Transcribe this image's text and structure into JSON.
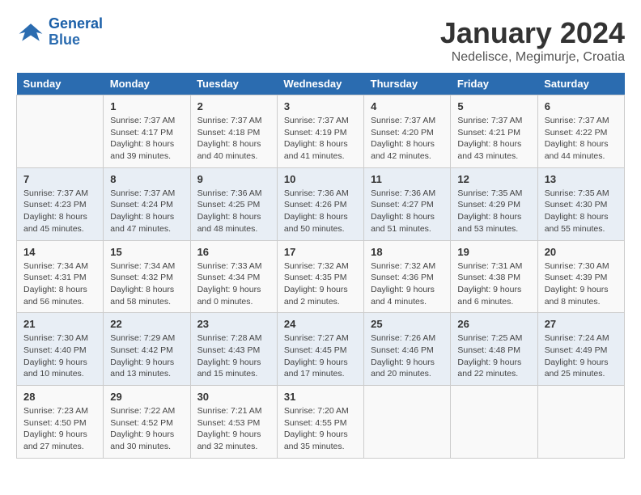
{
  "header": {
    "logo_line1": "General",
    "logo_line2": "Blue",
    "title": "January 2024",
    "subtitle": "Nedelisce, Megimurje, Croatia"
  },
  "calendar": {
    "weekdays": [
      "Sunday",
      "Monday",
      "Tuesday",
      "Wednesday",
      "Thursday",
      "Friday",
      "Saturday"
    ],
    "rows": [
      [
        {
          "day": "",
          "lines": []
        },
        {
          "day": "1",
          "lines": [
            "Sunrise: 7:37 AM",
            "Sunset: 4:17 PM",
            "Daylight: 8 hours",
            "and 39 minutes."
          ]
        },
        {
          "day": "2",
          "lines": [
            "Sunrise: 7:37 AM",
            "Sunset: 4:18 PM",
            "Daylight: 8 hours",
            "and 40 minutes."
          ]
        },
        {
          "day": "3",
          "lines": [
            "Sunrise: 7:37 AM",
            "Sunset: 4:19 PM",
            "Daylight: 8 hours",
            "and 41 minutes."
          ]
        },
        {
          "day": "4",
          "lines": [
            "Sunrise: 7:37 AM",
            "Sunset: 4:20 PM",
            "Daylight: 8 hours",
            "and 42 minutes."
          ]
        },
        {
          "day": "5",
          "lines": [
            "Sunrise: 7:37 AM",
            "Sunset: 4:21 PM",
            "Daylight: 8 hours",
            "and 43 minutes."
          ]
        },
        {
          "day": "6",
          "lines": [
            "Sunrise: 7:37 AM",
            "Sunset: 4:22 PM",
            "Daylight: 8 hours",
            "and 44 minutes."
          ]
        }
      ],
      [
        {
          "day": "7",
          "lines": [
            "Sunrise: 7:37 AM",
            "Sunset: 4:23 PM",
            "Daylight: 8 hours",
            "and 45 minutes."
          ]
        },
        {
          "day": "8",
          "lines": [
            "Sunrise: 7:37 AM",
            "Sunset: 4:24 PM",
            "Daylight: 8 hours",
            "and 47 minutes."
          ]
        },
        {
          "day": "9",
          "lines": [
            "Sunrise: 7:36 AM",
            "Sunset: 4:25 PM",
            "Daylight: 8 hours",
            "and 48 minutes."
          ]
        },
        {
          "day": "10",
          "lines": [
            "Sunrise: 7:36 AM",
            "Sunset: 4:26 PM",
            "Daylight: 8 hours",
            "and 50 minutes."
          ]
        },
        {
          "day": "11",
          "lines": [
            "Sunrise: 7:36 AM",
            "Sunset: 4:27 PM",
            "Daylight: 8 hours",
            "and 51 minutes."
          ]
        },
        {
          "day": "12",
          "lines": [
            "Sunrise: 7:35 AM",
            "Sunset: 4:29 PM",
            "Daylight: 8 hours",
            "and 53 minutes."
          ]
        },
        {
          "day": "13",
          "lines": [
            "Sunrise: 7:35 AM",
            "Sunset: 4:30 PM",
            "Daylight: 8 hours",
            "and 55 minutes."
          ]
        }
      ],
      [
        {
          "day": "14",
          "lines": [
            "Sunrise: 7:34 AM",
            "Sunset: 4:31 PM",
            "Daylight: 8 hours",
            "and 56 minutes."
          ]
        },
        {
          "day": "15",
          "lines": [
            "Sunrise: 7:34 AM",
            "Sunset: 4:32 PM",
            "Daylight: 8 hours",
            "and 58 minutes."
          ]
        },
        {
          "day": "16",
          "lines": [
            "Sunrise: 7:33 AM",
            "Sunset: 4:34 PM",
            "Daylight: 9 hours",
            "and 0 minutes."
          ]
        },
        {
          "day": "17",
          "lines": [
            "Sunrise: 7:32 AM",
            "Sunset: 4:35 PM",
            "Daylight: 9 hours",
            "and 2 minutes."
          ]
        },
        {
          "day": "18",
          "lines": [
            "Sunrise: 7:32 AM",
            "Sunset: 4:36 PM",
            "Daylight: 9 hours",
            "and 4 minutes."
          ]
        },
        {
          "day": "19",
          "lines": [
            "Sunrise: 7:31 AM",
            "Sunset: 4:38 PM",
            "Daylight: 9 hours",
            "and 6 minutes."
          ]
        },
        {
          "day": "20",
          "lines": [
            "Sunrise: 7:30 AM",
            "Sunset: 4:39 PM",
            "Daylight: 9 hours",
            "and 8 minutes."
          ]
        }
      ],
      [
        {
          "day": "21",
          "lines": [
            "Sunrise: 7:30 AM",
            "Sunset: 4:40 PM",
            "Daylight: 9 hours",
            "and 10 minutes."
          ]
        },
        {
          "day": "22",
          "lines": [
            "Sunrise: 7:29 AM",
            "Sunset: 4:42 PM",
            "Daylight: 9 hours",
            "and 13 minutes."
          ]
        },
        {
          "day": "23",
          "lines": [
            "Sunrise: 7:28 AM",
            "Sunset: 4:43 PM",
            "Daylight: 9 hours",
            "and 15 minutes."
          ]
        },
        {
          "day": "24",
          "lines": [
            "Sunrise: 7:27 AM",
            "Sunset: 4:45 PM",
            "Daylight: 9 hours",
            "and 17 minutes."
          ]
        },
        {
          "day": "25",
          "lines": [
            "Sunrise: 7:26 AM",
            "Sunset: 4:46 PM",
            "Daylight: 9 hours",
            "and 20 minutes."
          ]
        },
        {
          "day": "26",
          "lines": [
            "Sunrise: 7:25 AM",
            "Sunset: 4:48 PM",
            "Daylight: 9 hours",
            "and 22 minutes."
          ]
        },
        {
          "day": "27",
          "lines": [
            "Sunrise: 7:24 AM",
            "Sunset: 4:49 PM",
            "Daylight: 9 hours",
            "and 25 minutes."
          ]
        }
      ],
      [
        {
          "day": "28",
          "lines": [
            "Sunrise: 7:23 AM",
            "Sunset: 4:50 PM",
            "Daylight: 9 hours",
            "and 27 minutes."
          ]
        },
        {
          "day": "29",
          "lines": [
            "Sunrise: 7:22 AM",
            "Sunset: 4:52 PM",
            "Daylight: 9 hours",
            "and 30 minutes."
          ]
        },
        {
          "day": "30",
          "lines": [
            "Sunrise: 7:21 AM",
            "Sunset: 4:53 PM",
            "Daylight: 9 hours",
            "and 32 minutes."
          ]
        },
        {
          "day": "31",
          "lines": [
            "Sunrise: 7:20 AM",
            "Sunset: 4:55 PM",
            "Daylight: 9 hours",
            "and 35 minutes."
          ]
        },
        {
          "day": "",
          "lines": []
        },
        {
          "day": "",
          "lines": []
        },
        {
          "day": "",
          "lines": []
        }
      ]
    ]
  }
}
